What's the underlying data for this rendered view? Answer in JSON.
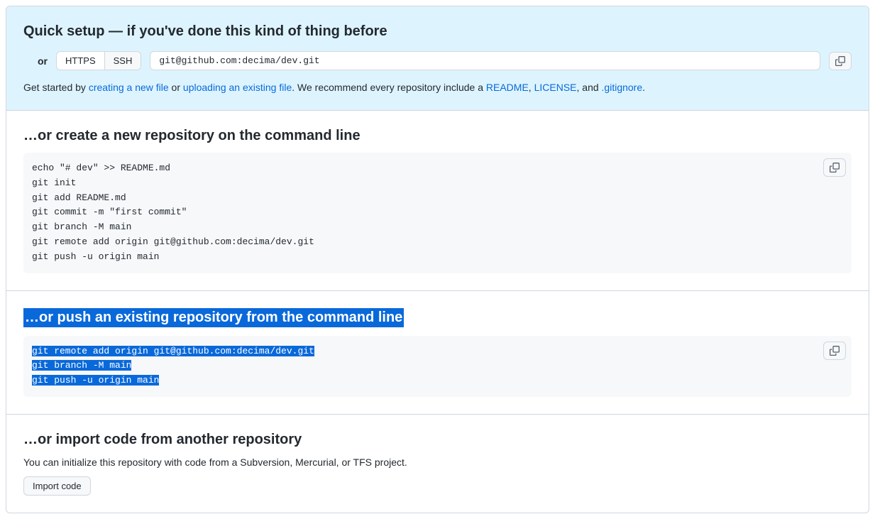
{
  "quickSetup": {
    "heading": "Quick setup — if you've done this kind of thing before",
    "or": "or",
    "httpsLabel": "HTTPS",
    "sshLabel": "SSH",
    "cloneUrl": "git@github.com:decima/dev.git",
    "getStarted": {
      "prefix": "Get started by ",
      "createLink": "creating a new file",
      "or": " or ",
      "uploadLink": "uploading an existing file",
      "mid": ". We recommend every repository include a ",
      "readmeLink": "README",
      "comma": ", ",
      "licenseLink": "LICENSE",
      "and": ", and ",
      "gitignoreLink": ".gitignore",
      "period": "."
    }
  },
  "createRepo": {
    "heading": "…or create a new repository on the command line",
    "code": "echo \"# dev\" >> README.md\ngit init\ngit add README.md\ngit commit -m \"first commit\"\ngit branch -M main\ngit remote add origin git@github.com:decima/dev.git\ngit push -u origin main"
  },
  "pushExisting": {
    "heading": "…or push an existing repository from the command line",
    "line1": "git remote add origin git@github.com:decima/dev.git",
    "line2": "git branch -M main",
    "line3": "git push -u origin main"
  },
  "importCode": {
    "heading": "…or import code from another repository",
    "desc": "You can initialize this repository with code from a Subversion, Mercurial, or TFS project.",
    "buttonLabel": "Import code"
  }
}
